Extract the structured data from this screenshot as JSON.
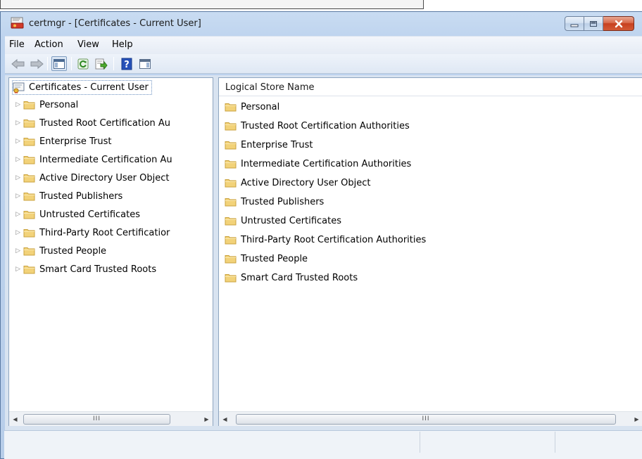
{
  "window": {
    "title": "certmgr - [Certificates - Current User]"
  },
  "menu": [
    "File",
    "Action",
    "View",
    "Help"
  ],
  "toolbar": {
    "buttons": [
      "back-icon",
      "forward-icon",
      "show-hide-console-tree-icon",
      "refresh-icon",
      "export-list-icon",
      "help-icon",
      "show-action-pane-icon"
    ]
  },
  "tree": {
    "root": "Certificates - Current User",
    "items": [
      "Personal",
      "Trusted Root Certification Au",
      "Enterprise Trust",
      "Intermediate Certification Au",
      "Active Directory User Object",
      "Trusted Publishers",
      "Untrusted Certificates",
      "Third-Party Root Certificatior",
      "Trusted People",
      "Smart Card Trusted Roots"
    ]
  },
  "list": {
    "column_header": "Logical Store Name",
    "items": [
      "Personal",
      "Trusted Root Certification Authorities",
      "Enterprise Trust",
      "Intermediate Certification Authorities",
      "Active Directory User Object",
      "Trusted Publishers",
      "Untrusted Certificates",
      "Third-Party Root Certification Authorities",
      "Trusted People",
      "Smart Card Trusted Roots"
    ]
  },
  "scrollbar": {
    "grip": "III"
  },
  "colors": {
    "window_frame": "#bdd3ee",
    "close_button": "#c7401f",
    "folder": "#f2d279"
  }
}
